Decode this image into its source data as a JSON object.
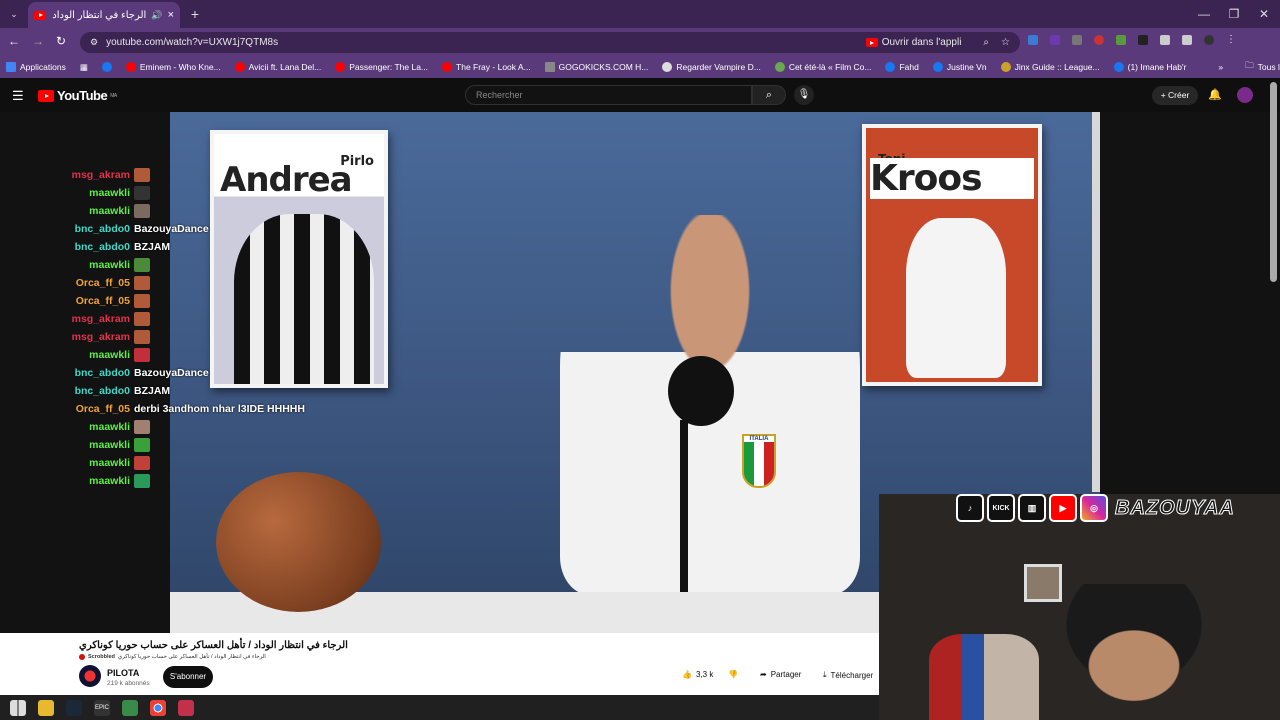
{
  "browser": {
    "tab_title": "الرجاء في انتظار الوداد / تأهل",
    "url": "youtube.com/watch?v=UXW1j7QTM8s",
    "open_in_app": "Ouvrir dans l'appli",
    "all_bookmarks": "Tous les favoris",
    "bookmarks": [
      {
        "label": "Applications",
        "color": "#4285f4"
      },
      {
        "label": "Eminem - Who Kne...",
        "color": "#ff0000"
      },
      {
        "label": "Avicii ft. Lana Del...",
        "color": "#ff0000"
      },
      {
        "label": "Passenger: The La...",
        "color": "#ff0000"
      },
      {
        "label": "The Fray - Look A...",
        "color": "#ff0000"
      },
      {
        "label": "GOGOKICKS.COM H...",
        "color": "#888888"
      },
      {
        "label": "Regarder Vampire D...",
        "color": "#dddddd"
      },
      {
        "label": "Cet été-là « Film Co...",
        "color": "#6aa84f"
      },
      {
        "label": "Fahd",
        "color": "#1877f2"
      },
      {
        "label": "Justine Vn",
        "color": "#1877f2"
      },
      {
        "label": "Jinx Guide :: League...",
        "color": "#c9a227"
      },
      {
        "label": "(1) Imane Hab'r",
        "color": "#1877f2"
      }
    ]
  },
  "youtube": {
    "logo": "YouTube",
    "logo_region": "MA",
    "search_placeholder": "Rechercher",
    "create_label": "Créer"
  },
  "video": {
    "poster_left_first": "Pirlo",
    "poster_left_last": "Andrea",
    "poster_right_first": "Toni",
    "poster_right_last": "Kroos",
    "jersey_text": "ITALIA"
  },
  "chat": [
    {
      "user": "msg_akram",
      "color": "#e0334a",
      "text": "",
      "emote": "#b05a3a"
    },
    {
      "user": "maawkli",
      "color": "#5ef04a",
      "text": "",
      "emote": "#333333"
    },
    {
      "user": "maawkli",
      "color": "#5ef04a",
      "text": "",
      "emote": "#7a6a60"
    },
    {
      "user": "bnc_abdo0",
      "color": "#3fd8c8",
      "text": "BazouyaDance",
      "emote": ""
    },
    {
      "user": "bnc_abdo0",
      "color": "#3fd8c8",
      "text": "BZJAM",
      "emote": ""
    },
    {
      "user": "maawkli",
      "color": "#5ef04a",
      "text": "",
      "emote": "#4a8a3a"
    },
    {
      "user": "Orca_ff_05",
      "color": "#f0a23a",
      "text": "",
      "emote": "#b05a3a"
    },
    {
      "user": "Orca_ff_05",
      "color": "#f0a23a",
      "text": "",
      "emote": "#b05a3a"
    },
    {
      "user": "msg_akram",
      "color": "#e0334a",
      "text": "",
      "emote": "#b05a3a"
    },
    {
      "user": "msg_akram",
      "color": "#e0334a",
      "text": "",
      "emote": "#b05a3a"
    },
    {
      "user": "maawkli",
      "color": "#5ef04a",
      "text": "",
      "emote": "#c0303a"
    },
    {
      "user": "bnc_abdo0",
      "color": "#3fd8c8",
      "text": "BazouyaDance",
      "emote": ""
    },
    {
      "user": "bnc_abdo0",
      "color": "#3fd8c8",
      "text": "BZJAM",
      "emote": ""
    },
    {
      "user": "Orca_ff_05",
      "color": "#f0a23a",
      "text": "derbi 3andhom nhar l3IDE HHHHH",
      "emote": ""
    },
    {
      "user": "maawkli",
      "color": "#5ef04a",
      "text": "",
      "emote": "#a08070"
    },
    {
      "user": "maawkli",
      "color": "#5ef04a",
      "text": "",
      "emote": "#3aa03a"
    },
    {
      "user": "maawkli",
      "color": "#5ef04a",
      "text": "",
      "emote": "#c0403a"
    },
    {
      "user": "maawkli",
      "color": "#5ef04a",
      "text": "",
      "emote": "#2a9a5a"
    }
  ],
  "overlay": {
    "kick_label": "KICK",
    "handle": "BAZOUYAA"
  },
  "details": {
    "title": "الرجاء في انتظار الوداد / تأهل العساكر على حساب حوريا كوناكري",
    "scrobbled_label": "Scrobbled",
    "scrobbled_title": "الرجاء في انتظار الوداد / تأهل العساكر على حساب حوريا كوناكري",
    "channel": "PILOTA",
    "subscribers": "219 k abonnés",
    "subscribe": "S'abonner",
    "likes": "3,3 k",
    "share": "Partager",
    "download": "Télécharger"
  }
}
